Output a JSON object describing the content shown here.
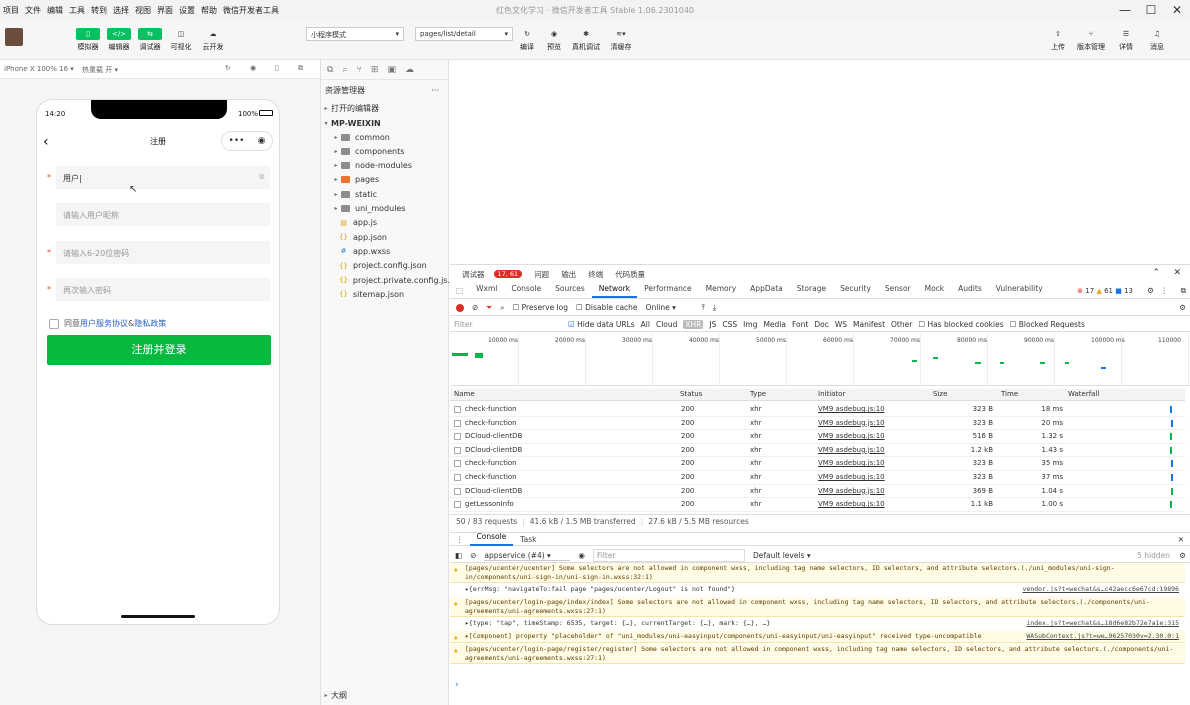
{
  "menu": [
    "项目",
    "文件",
    "编辑",
    "工具",
    "转到",
    "选择",
    "视图",
    "界面",
    "设置",
    "帮助",
    "微信开发者工具"
  ],
  "window_title": "红色文化学习 · 微信开发者工具 Stable 1.06.2301040",
  "toolbar": {
    "simulator": "模拟器",
    "editor": "编辑器",
    "debugger": "调试器",
    "visual": "可视化",
    "cloud": "云开发",
    "mode": "小程序模式",
    "page": "pages/list/detail",
    "compile": "编译",
    "preview": "预览",
    "realdebug": "真机调试",
    "clearcache": "清缓存",
    "upload": "上传",
    "version": "版本管理",
    "details": "详情",
    "messages": "消息"
  },
  "simbar": {
    "device": "iPhone X 100% 16 ▾",
    "hotreload": "热重载 开 ▾"
  },
  "phone": {
    "time": "14:20",
    "battery": "100%",
    "title": "注册",
    "username_value": "用户",
    "nickname_placeholder": "请输入用户昵称",
    "password_placeholder": "请输入6-20位密码",
    "password2_placeholder": "再次输入密码",
    "agree_prefix": "同意",
    "agree_service": "用户服务协议",
    "agree_and": "&",
    "agree_privacy": "隐私政策",
    "register_button": "注册并登录"
  },
  "explorer": {
    "title": "资源管理器",
    "open_editors": "打开的编辑器",
    "project": "MP-WEIXIN",
    "outline": "大纲",
    "items": [
      {
        "name": "common",
        "type": "folder"
      },
      {
        "name": "components",
        "type": "folder"
      },
      {
        "name": "node-modules",
        "type": "folder"
      },
      {
        "name": "pages",
        "type": "folder-orange"
      },
      {
        "name": "static",
        "type": "folder"
      },
      {
        "name": "uni_modules",
        "type": "folder"
      },
      {
        "name": "app.js",
        "type": "js"
      },
      {
        "name": "app.json",
        "type": "json"
      },
      {
        "name": "app.wxss",
        "type": "wxss"
      },
      {
        "name": "project.config.json",
        "type": "json"
      },
      {
        "name": "project.private.config.js...",
        "type": "json"
      },
      {
        "name": "sitemap.json",
        "type": "json"
      }
    ]
  },
  "devtools": {
    "top_tabs": [
      "调试器",
      "问题",
      "输出",
      "终端",
      "代码质量"
    ],
    "badge": "17, 61",
    "tabs": [
      "Wxml",
      "Console",
      "Sources",
      "Network",
      "Performance",
      "Memory",
      "AppData",
      "Storage",
      "Security",
      "Sensor",
      "Mock",
      "Audits",
      "Vulnerability"
    ],
    "active_tab": "Network",
    "errors": "17",
    "warnings": "61",
    "infos": "13",
    "preserve_log": "Preserve log",
    "disable_cache": "Disable cache",
    "throttle": "Online",
    "filter_placeholder": "Filter",
    "hide_data_urls": "Hide data URLs",
    "type_filters": [
      "All",
      "Cloud",
      "XHR",
      "JS",
      "CSS",
      "Img",
      "Media",
      "Font",
      "Doc",
      "WS",
      "Manifest",
      "Other"
    ],
    "has_blocked": "Has blocked cookies",
    "blocked_requests": "Blocked Requests",
    "timeline_ticks": [
      "10000 ms",
      "20000 ms",
      "30000 ms",
      "40000 ms",
      "50000 ms",
      "60000 ms",
      "70000 ms",
      "80000 ms",
      "90000 ms",
      "100000 ms",
      "110000"
    ],
    "columns": [
      "Name",
      "Status",
      "Type",
      "Initiator",
      "Size",
      "Time",
      "Waterfall"
    ],
    "rows": [
      {
        "name": "check-function",
        "status": "200",
        "type": "xhr",
        "initiator": "VM9 asdebug.js:10",
        "size": "323 B",
        "time": "18 ms"
      },
      {
        "name": "check-function",
        "status": "200",
        "type": "xhr",
        "initiator": "VM9 asdebug.js:10",
        "size": "323 B",
        "time": "20 ms"
      },
      {
        "name": "DCloud-clientDB",
        "status": "200",
        "type": "xhr",
        "initiator": "VM9 asdebug.js:10",
        "size": "516 B",
        "time": "1.32 s"
      },
      {
        "name": "DCloud-clientDB",
        "status": "200",
        "type": "xhr",
        "initiator": "VM9 asdebug.js:10",
        "size": "1.2 kB",
        "time": "1.43 s"
      },
      {
        "name": "check-function",
        "status": "200",
        "type": "xhr",
        "initiator": "VM9 asdebug.js:10",
        "size": "323 B",
        "time": "35 ms"
      },
      {
        "name": "check-function",
        "status": "200",
        "type": "xhr",
        "initiator": "VM9 asdebug.js:10",
        "size": "323 B",
        "time": "37 ms"
      },
      {
        "name": "DCloud-clientDB",
        "status": "200",
        "type": "xhr",
        "initiator": "VM9 asdebug.js:10",
        "size": "369 B",
        "time": "1.04 s"
      },
      {
        "name": "getLessonInfo",
        "status": "200",
        "type": "xhr",
        "initiator": "VM9 asdebug.js:10",
        "size": "1.1 kB",
        "time": "1.00 s"
      }
    ],
    "summary_requests": "50 / 83 requests",
    "summary_transferred": "41.6 kB / 1.5 MB transferred",
    "summary_resources": "27.6 kB / 5.5 MB resources",
    "drawer_tabs": [
      "Console",
      "Task"
    ],
    "context": "appservice (#4)",
    "console_filter": "Filter",
    "levels": "Default levels ▾",
    "hidden": "5 hidden",
    "console": [
      {
        "kind": "warn",
        "text": "[pages/ucenter/ucenter] Some selectors are not allowed in component wxss, including tag name selectors, ID selectors, and attribute selectors.(./uni_modules/uni-sign-in/components/uni-sign-in/uni-sign-in.wxss:32:1)",
        "src": ""
      },
      {
        "kind": "info",
        "text": "▸{errMsg: \"navigateTo:fail page \"pages/ucenter/Logout\" is not found\"}",
        "src": "vendor.js?t=wechat&s…c42aecc6e67cd:19896"
      },
      {
        "kind": "warn",
        "text": "[pages/ucenter/login-page/index/index] Some selectors are not allowed in component wxss, including tag name selectors, ID selectors, and attribute selectors.(./components/uni-agreements/uni-agreements.wxss:27:1)",
        "src": ""
      },
      {
        "kind": "info",
        "text": "▸{type: \"tap\", timeStamp: 6535, target: {…}, currentTarget: {…}, mark: {…}, …}",
        "src": "index.js?t=wechat&s…18d6e82b72e7a1e:315"
      },
      {
        "kind": "warn",
        "text": "▸[Component] property \"placeholder\" of \"uni_modules/uni-easyinput/components/uni-easyinput/uni-easyinput\" received type-uncompatible value: expected <String> but get null value. Use empty string instead.",
        "src": "WASubContext.js?t=we…96257030v=2.30.0:1"
      },
      {
        "kind": "warn",
        "text": "[pages/ucenter/login-page/register/register] Some selectors are not allowed in component wxss, including tag name selectors, ID selectors, and attribute selectors.(./components/uni-agreements/uni-agreements.wxss:27:1)",
        "src": ""
      }
    ],
    "prompt": "›"
  }
}
